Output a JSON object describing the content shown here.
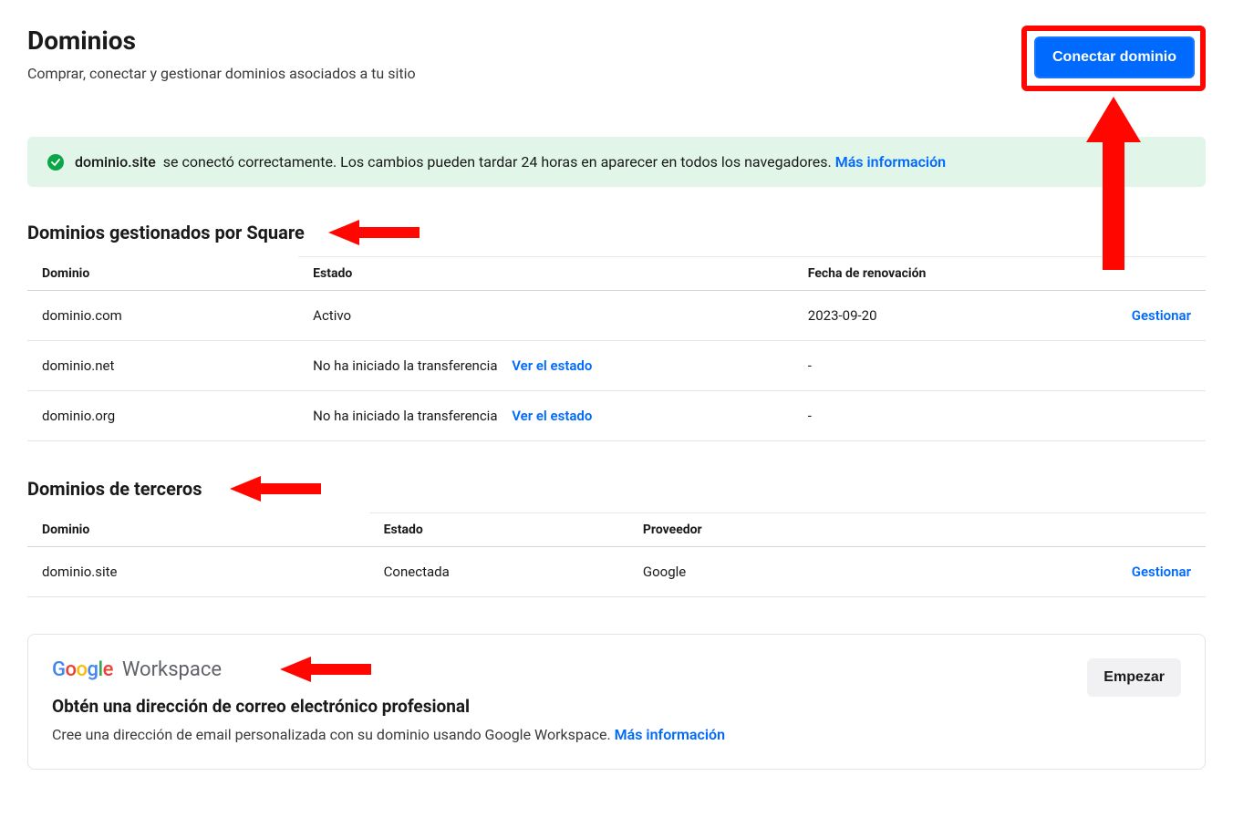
{
  "header": {
    "title": "Dominios",
    "subtitle": "Comprar, conectar y gestionar dominios asociados a tu sitio",
    "connect_button": "Conectar dominio"
  },
  "alert": {
    "domain": "dominio.site",
    "message": "se conectó correctamente. Los cambios pueden tardar 24 horas en aparecer en todos los navegadores.",
    "more_info": "Más información"
  },
  "square": {
    "title": "Dominios gestionados por Square",
    "columns": {
      "domain": "Dominio",
      "status": "Estado",
      "renew": "Fecha de renovación"
    },
    "rows": [
      {
        "domain": "dominio.com",
        "status": "Activo",
        "status_link": "",
        "renew": "2023-09-20",
        "action": "Gestionar"
      },
      {
        "domain": "dominio.net",
        "status": "No ha iniciado la transferencia",
        "status_link": "Ver el estado",
        "renew": "-",
        "action": ""
      },
      {
        "domain": "dominio.org",
        "status": "No ha iniciado la transferencia",
        "status_link": "Ver el estado",
        "renew": "-",
        "action": ""
      }
    ]
  },
  "thirdparty": {
    "title": "Dominios de terceros",
    "columns": {
      "domain": "Dominio",
      "status": "Estado",
      "provider": "Proveedor"
    },
    "rows": [
      {
        "domain": "dominio.site",
        "status": "Conectada",
        "provider": "Google",
        "action": "Gestionar"
      }
    ]
  },
  "workspace": {
    "logo_workspace": "Workspace",
    "title": "Obtén una dirección de correo electrónico profesional",
    "desc": "Cree una dirección de email personalizada con su dominio usando Google Workspace.",
    "more_info": "Más información",
    "button": "Empezar"
  }
}
